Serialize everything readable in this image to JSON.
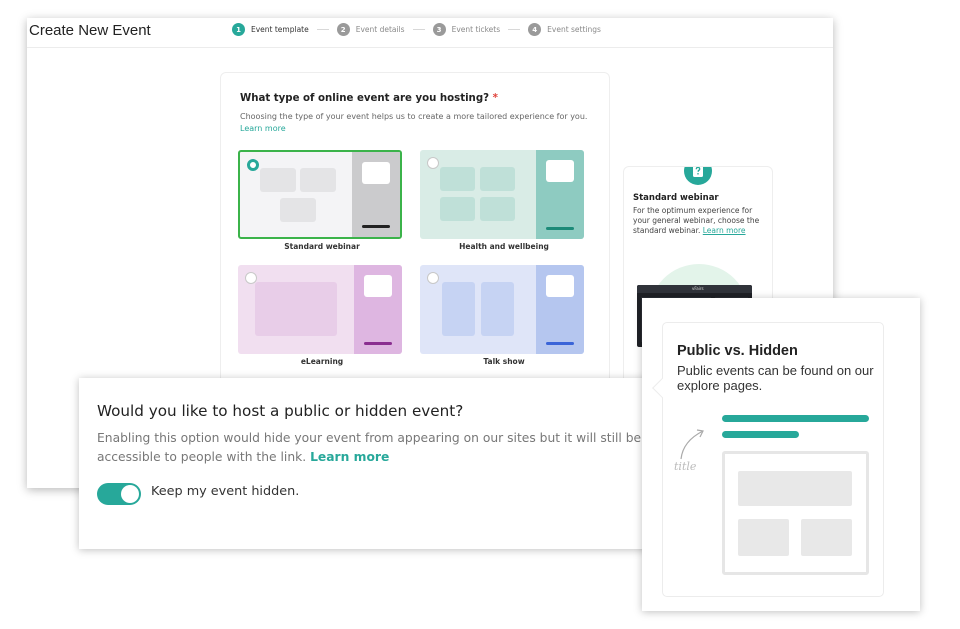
{
  "header": {
    "title": "Create New Event",
    "steps": [
      {
        "num": "1",
        "label": "Event template",
        "active": true
      },
      {
        "num": "2",
        "label": "Event details",
        "active": false
      },
      {
        "num": "3",
        "label": "Event tickets",
        "active": false
      },
      {
        "num": "4",
        "label": "Event settings",
        "active": false
      }
    ]
  },
  "event_type": {
    "question": "What type of online event are you hosting?",
    "required_mark": "*",
    "description": "Choosing the type of your event helps us to create a more tailored experience for you.",
    "learn_more": "Learn more",
    "templates": [
      {
        "label": "Standard webinar",
        "selected": true,
        "bg": "#f4f4f6",
        "panel": "#cbcbcd",
        "accent": "#222222",
        "block": "#e4e4e6"
      },
      {
        "label": "Health and wellbeing",
        "selected": false,
        "bg": "#d9ece6",
        "panel": "#8ecbc1",
        "accent": "#1c8a78",
        "block": "#bfe0d8"
      },
      {
        "label": "eLearning",
        "selected": false,
        "bg": "#f1dff0",
        "panel": "#deb6e1",
        "accent": "#8a2e90",
        "block": "#e8cde8"
      },
      {
        "label": "Talk show",
        "selected": false,
        "bg": "#dfe5f8",
        "panel": "#b5c6ef",
        "accent": "#3a64d8",
        "block": "#c6d3f3"
      }
    ]
  },
  "side_info": {
    "icon": "question-icon",
    "title": "Standard webinar",
    "description": "For the optimum experience for your general webinar, choose the standard webinar.",
    "learn_more": "Learn more",
    "thumb_header": "vFairs"
  },
  "hidden_event": {
    "title": "Would you like to host a public or hidden event?",
    "description": "Enabling this option would hide your event from appearing on our sites but it will still be accessible to people with the link.",
    "learn_more": "Learn more",
    "toggle_label": "Keep my event hidden.",
    "toggle_on": true
  },
  "popup": {
    "title": "Public vs. Hidden",
    "description": "Public events can be found on our explore pages.",
    "sketch_text": "title"
  },
  "colors": {
    "accent": "#27a89a",
    "selected_border": "#3bb34a",
    "required": "#e0423a"
  }
}
